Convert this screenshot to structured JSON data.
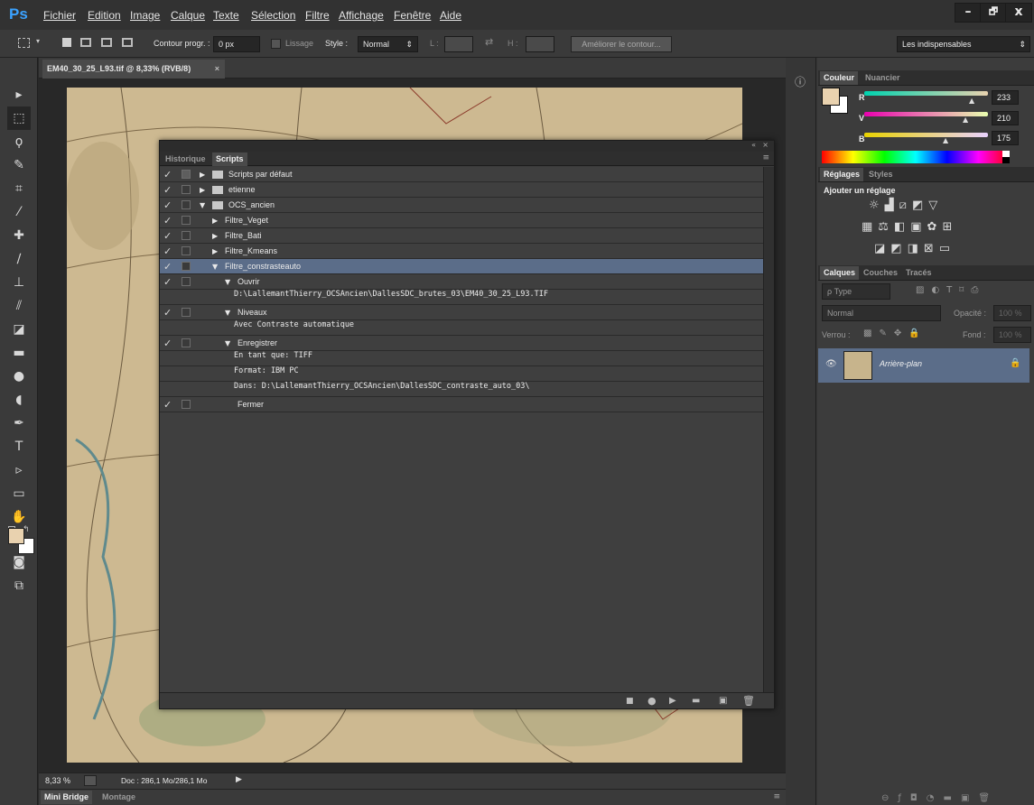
{
  "app": {
    "logo": "Ps"
  },
  "menu": [
    "Fichier",
    "Edition",
    "Image",
    "Calque",
    "Texte",
    "Sélection",
    "Filtre",
    "Affichage",
    "Fenêtre",
    "Aide"
  ],
  "window_controls": {
    "minimize": "–",
    "restore": "🗗",
    "close": "x"
  },
  "options": {
    "feather_label": "Contour progr. :",
    "feather_value": "0 px",
    "antialias_label": "Lissage",
    "style_label": "Style :",
    "style_value": "Normal",
    "width_label": "L :",
    "height_label": "H :",
    "refine_button": "Améliorer le contour...",
    "workspace": "Les indispensables"
  },
  "document": {
    "tab_title": "EM40_30_25_L93.tif @ 8,33% (RVB/8)",
    "close": "×",
    "zoom": "8,33 %",
    "doc_info": "Doc : 286,1 Mo/286,1 Mo"
  },
  "bottom_tabs": {
    "mini_bridge": "Mini Bridge",
    "montage": "Montage"
  },
  "scripts_panel": {
    "tabs": [
      "Historique",
      "Scripts"
    ],
    "active_tab": "Scripts",
    "rows": [
      {
        "check": "✓",
        "dialog": true,
        "expand": "▶",
        "folder": true,
        "label": "Scripts par défaut",
        "indent": 0,
        "sub": false,
        "selected": false
      },
      {
        "check": "✓",
        "dialog": false,
        "expand": "▶",
        "folder": true,
        "label": "etienne",
        "indent": 0,
        "sub": false,
        "selected": false
      },
      {
        "check": "✓",
        "dialog": false,
        "expand": "▼",
        "folder": true,
        "label": "OCS_ancien",
        "indent": 0,
        "sub": false,
        "selected": false
      },
      {
        "check": "✓",
        "dialog": false,
        "expand": "▶",
        "folder": false,
        "label": "Filtre_Veget",
        "indent": 1,
        "sub": false,
        "selected": false
      },
      {
        "check": "✓",
        "dialog": false,
        "expand": "▶",
        "folder": false,
        "label": "Filtre_Bati",
        "indent": 1,
        "sub": false,
        "selected": false
      },
      {
        "check": "✓",
        "dialog": false,
        "expand": "▶",
        "folder": false,
        "label": "Filtre_Kmeans",
        "indent": 1,
        "sub": false,
        "selected": false
      },
      {
        "check": "✓",
        "dialog": false,
        "expand": "▼",
        "folder": false,
        "label": "Filtre_constrasteauto",
        "indent": 1,
        "sub": false,
        "selected": true
      },
      {
        "check": "✓",
        "dialog": false,
        "expand": "▼",
        "folder": false,
        "label": "Ouvrir",
        "indent": 2,
        "sub": false,
        "selected": false
      },
      {
        "check": "",
        "dialog": null,
        "expand": "",
        "folder": false,
        "label": "D:\\LallemantThierry_OCSAncien\\DallesSDC_brutes_03\\EM40_30_25_L93.TIF",
        "indent": 3,
        "sub": true,
        "selected": false
      },
      {
        "check": "✓",
        "dialog": false,
        "expand": "▼",
        "folder": false,
        "label": "Niveaux",
        "indent": 2,
        "sub": false,
        "selected": false
      },
      {
        "check": "",
        "dialog": null,
        "expand": "",
        "folder": false,
        "label": "Avec Contraste automatique",
        "indent": 3,
        "sub": true,
        "selected": false
      },
      {
        "check": "✓",
        "dialog": false,
        "expand": "▼",
        "folder": false,
        "label": "Enregistrer",
        "indent": 2,
        "sub": false,
        "selected": false
      },
      {
        "check": "",
        "dialog": null,
        "expand": "",
        "folder": false,
        "label": "En tant que: TIFF",
        "indent": 3,
        "sub": true,
        "selected": false
      },
      {
        "check": "",
        "dialog": null,
        "expand": "",
        "folder": false,
        "label": "Format: IBM PC",
        "indent": 3,
        "sub": true,
        "selected": false
      },
      {
        "check": "",
        "dialog": null,
        "expand": "",
        "folder": false,
        "label": "Dans: D:\\LallemantThierry_OCSAncien\\DallesSDC_contraste_auto_03\\",
        "indent": 3,
        "sub": true,
        "selected": false
      },
      {
        "check": "✓",
        "dialog": false,
        "expand": "",
        "folder": false,
        "label": "Fermer",
        "indent": 2,
        "sub": false,
        "selected": false
      }
    ]
  },
  "color_panel": {
    "tabs": [
      "Couleur",
      "Nuancier"
    ],
    "channels": [
      {
        "label": "R",
        "value": "233"
      },
      {
        "label": "V",
        "value": "210"
      },
      {
        "label": "B",
        "value": "175"
      }
    ],
    "foreground": "#e9d2af"
  },
  "adjust_panel": {
    "tabs": [
      "Réglages",
      "Styles"
    ],
    "heading": "Ajouter un réglage"
  },
  "layers_panel": {
    "tabs": [
      "Calques",
      "Couches",
      "Tracés"
    ],
    "filter": "ρ Type",
    "blend": "Normal",
    "opacity_label": "Opacité :",
    "opacity": "100 %",
    "lock_label": "Verrou :",
    "fill_label": "Fond :",
    "fill": "100 %",
    "layer_name": "Arrière-plan"
  }
}
